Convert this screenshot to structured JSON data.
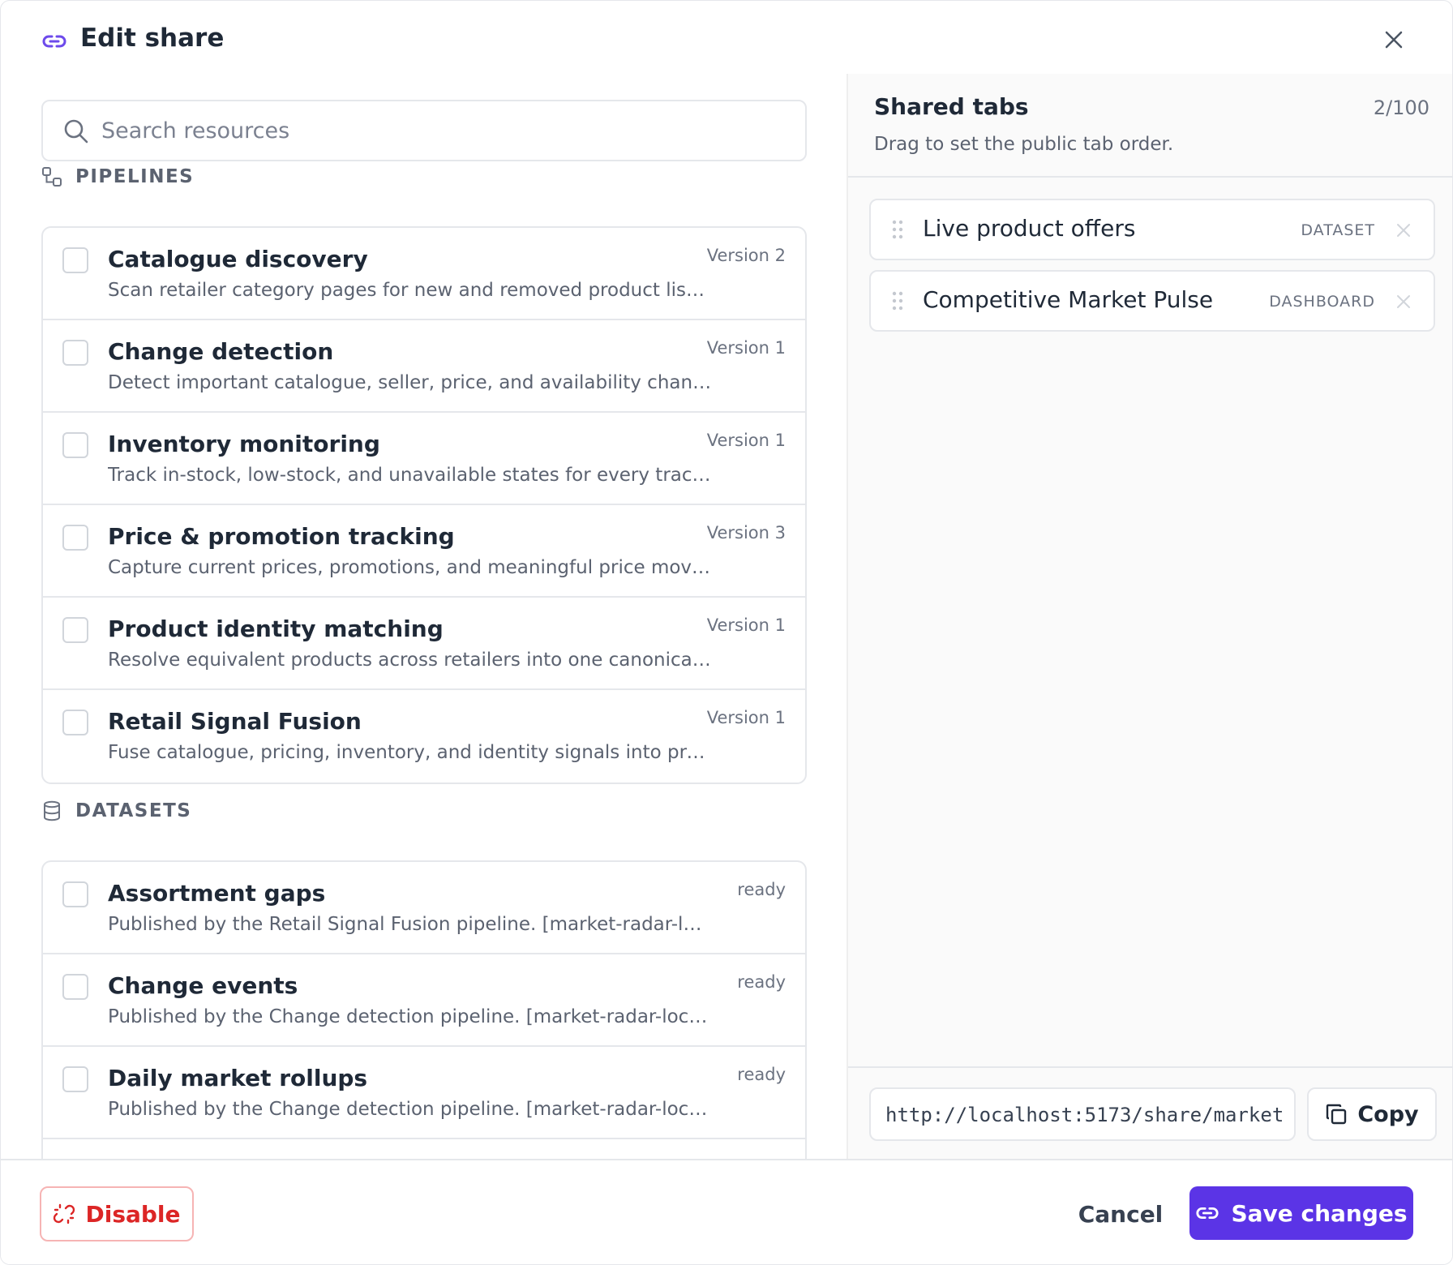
{
  "modal": {
    "title": "Edit share",
    "icon": "link-icon"
  },
  "search": {
    "placeholder": "Search resources"
  },
  "pipelines": {
    "label": "PIPELINES",
    "items": [
      {
        "title": "Catalogue discovery",
        "description": "Scan retailer category pages for new and removed product listi…",
        "meta": "Version 2"
      },
      {
        "title": "Change detection",
        "description": "Detect important catalogue, seller, price, and availability chang…",
        "meta": "Version 1"
      },
      {
        "title": "Inventory monitoring",
        "description": "Track in-stock, low-stock, and unavailable states for every trac…",
        "meta": "Version 1"
      },
      {
        "title": "Price & promotion tracking",
        "description": "Capture current prices, promotions, and meaningful price mov…",
        "meta": "Version 3"
      },
      {
        "title": "Product identity matching",
        "description": "Resolve equivalent products across retailers into one canonical…",
        "meta": "Version 1"
      },
      {
        "title": "Retail Signal Fusion",
        "description": "Fuse catalogue, pricing, inventory, and identity signals into pro…",
        "meta": "Version 1"
      }
    ]
  },
  "datasets": {
    "label": "DATASETS",
    "items": [
      {
        "title": "Assortment gaps",
        "description": "Published by the Retail Signal Fusion pipeline. [market-radar-local…",
        "meta": "ready"
      },
      {
        "title": "Change events",
        "description": "Published by the Change detection pipeline. [market-radar-local-…",
        "meta": "ready"
      },
      {
        "title": "Daily market rollups",
        "description": "Published by the Change detection pipeline. [market-radar-local-…",
        "meta": "ready"
      }
    ]
  },
  "shared_tabs": {
    "title": "Shared tabs",
    "count": "2/100",
    "subtitle": "Drag to set the public tab order.",
    "tabs": [
      {
        "name": "Live product offers",
        "type": "DATASET"
      },
      {
        "name": "Competitive Market Pulse",
        "type": "DASHBOARD"
      }
    ]
  },
  "share_link": {
    "url": "http://localhost:5173/share/market",
    "copy_label": "Copy"
  },
  "footer": {
    "disable_label": "Disable",
    "cancel_label": "Cancel",
    "save_label": "Save changes"
  },
  "colors": {
    "accent": "#5b34e6",
    "danger": "#dc2626",
    "border": "#e5e7eb"
  }
}
